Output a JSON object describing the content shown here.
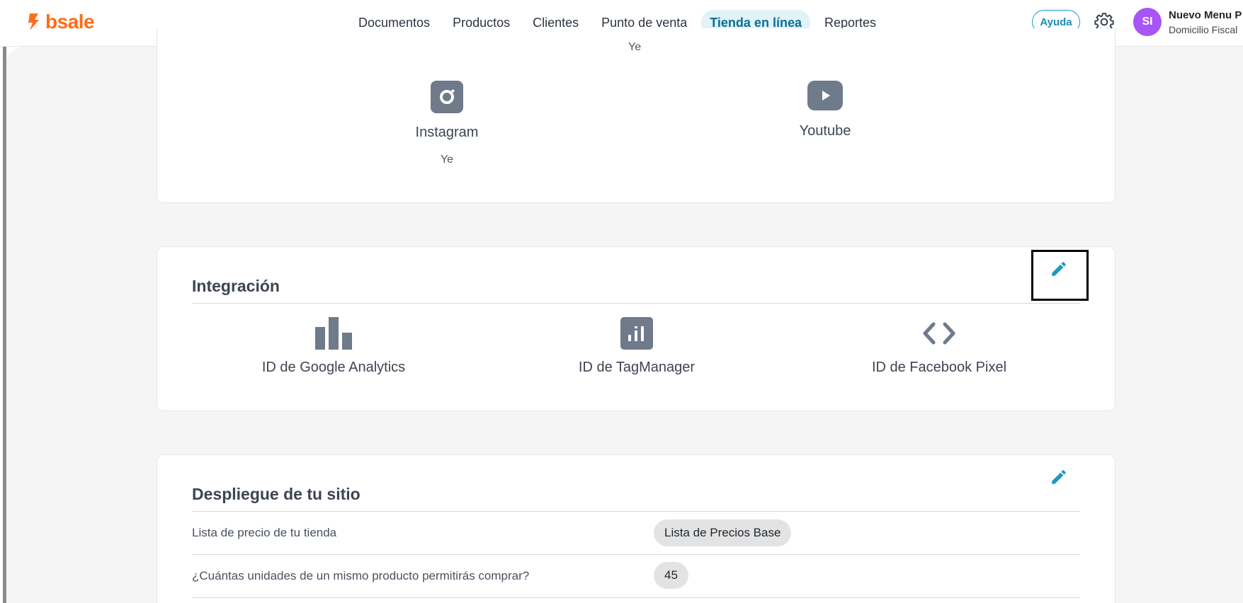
{
  "brand": {
    "name": "bsale",
    "color": "#ff6b1a"
  },
  "nav": {
    "items": [
      {
        "label": "Documentos"
      },
      {
        "label": "Productos"
      },
      {
        "label": "Clientes"
      },
      {
        "label": "Punto de venta"
      },
      {
        "label": "Tienda en línea",
        "active": true
      },
      {
        "label": "Reportes"
      }
    ]
  },
  "header": {
    "help_label": "Ayuda",
    "settings_icon": "gear-icon",
    "avatar_initials": "SI",
    "user_name": "Nuevo Menu P",
    "user_sub": "Domicilio Fiscal"
  },
  "social": {
    "partial_value": "Ye",
    "items": [
      {
        "label": "Instagram",
        "value": "Ye",
        "icon": "instagram-icon"
      },
      {
        "label": "Youtube",
        "value": "",
        "icon": "youtube-icon"
      }
    ]
  },
  "integration": {
    "title": "Integración",
    "items": [
      {
        "label": "ID de Google Analytics",
        "icon": "bar-chart-icon"
      },
      {
        "label": "ID de TagManager",
        "icon": "tag-manager-icon"
      },
      {
        "label": "ID de Facebook Pixel",
        "icon": "code-icon"
      }
    ]
  },
  "deploy": {
    "title": "Despliegue de tu sitio",
    "rows": [
      {
        "label": "Lista de precio de tu tienda",
        "value": "Lista de Precios Base"
      },
      {
        "label": "¿Cuántas unidades de un mismo producto permitirás comprar?",
        "value": "45"
      }
    ]
  },
  "colors": {
    "accent": "#1a9bc7",
    "icon_gray": "#6f7a8a",
    "active_nav_bg": "#e1f2f8"
  }
}
